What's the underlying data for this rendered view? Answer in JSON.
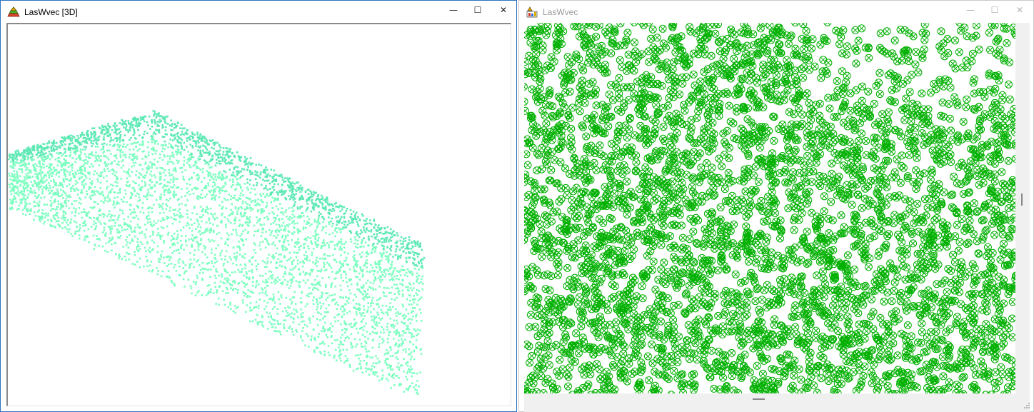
{
  "left_window": {
    "title": "LasWvec [3D]",
    "icon": "laswvec-app-icon",
    "controls": {
      "minimize": "—",
      "maximize": "☐",
      "close": "✕"
    },
    "view": {
      "type": "3d-point-cloud",
      "point_color": "#7dffc0",
      "point_color_dark": "#5ee9b5"
    }
  },
  "right_window": {
    "title": "LasWvec",
    "icon": "laswvec-doc-icon",
    "controls": {
      "minimize": "—",
      "maximize": "☐",
      "close": "✕"
    },
    "view": {
      "type": "2d-point-plot",
      "marker": "circle-cross",
      "marker_color": "#00b000"
    }
  },
  "colors": {
    "active_border": "#2b73c4",
    "inactive_border": "#c9c9c9",
    "client_background": "#ffffff",
    "frame_background": "#f0f0f0"
  }
}
